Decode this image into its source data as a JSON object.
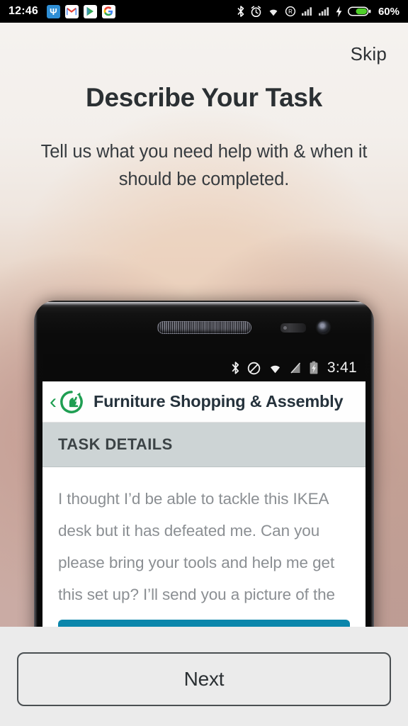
{
  "status_bar": {
    "time": "12:46",
    "battery_percent": "60%",
    "left_icons": [
      {
        "name": "usb-icon",
        "glyph": "Ψ"
      },
      {
        "name": "gmail-icon",
        "glyph": "M"
      },
      {
        "name": "play-store-icon",
        "glyph": "▶"
      },
      {
        "name": "google-icon",
        "glyph": "G"
      }
    ],
    "right_icons": [
      "bluetooth-icon",
      "alarm-icon",
      "wifi-icon",
      "r-badge-icon",
      "signal-1-icon",
      "signal-2-icon",
      "charging-bolt-icon",
      "battery-icon"
    ]
  },
  "onboarding": {
    "skip_label": "Skip",
    "title": "Describe Your Task",
    "subtitle": "Tell us what you need help with & when it should be completed.",
    "next_label": "Next"
  },
  "phone_preview": {
    "status_bar": {
      "time": "3:41",
      "icons": [
        "bluetooth-icon",
        "do-not-disturb-icon",
        "wifi-icon",
        "no-signal-icon",
        "charging-battery-icon"
      ]
    },
    "app_header": {
      "back_chevron": "‹",
      "logo": "taskrabbit-rabbit-logo",
      "title": "Furniture Shopping & Assembly"
    },
    "section_header": "TASK DETAILS",
    "task_description": "I thought I’d be able to tackle this IKEA desk but it has defeated me. Can you please bring your tools and help me get this set up? I’ll send you a picture of the current state of assembly to give you an",
    "cta_color": "#0b86ab"
  },
  "colors": {
    "brand_green": "#1f9e52",
    "cta_blue": "#0b86ab",
    "battery_green": "#4fd02a",
    "footer_bg": "#ebebeb",
    "heading": "#2b3033"
  }
}
